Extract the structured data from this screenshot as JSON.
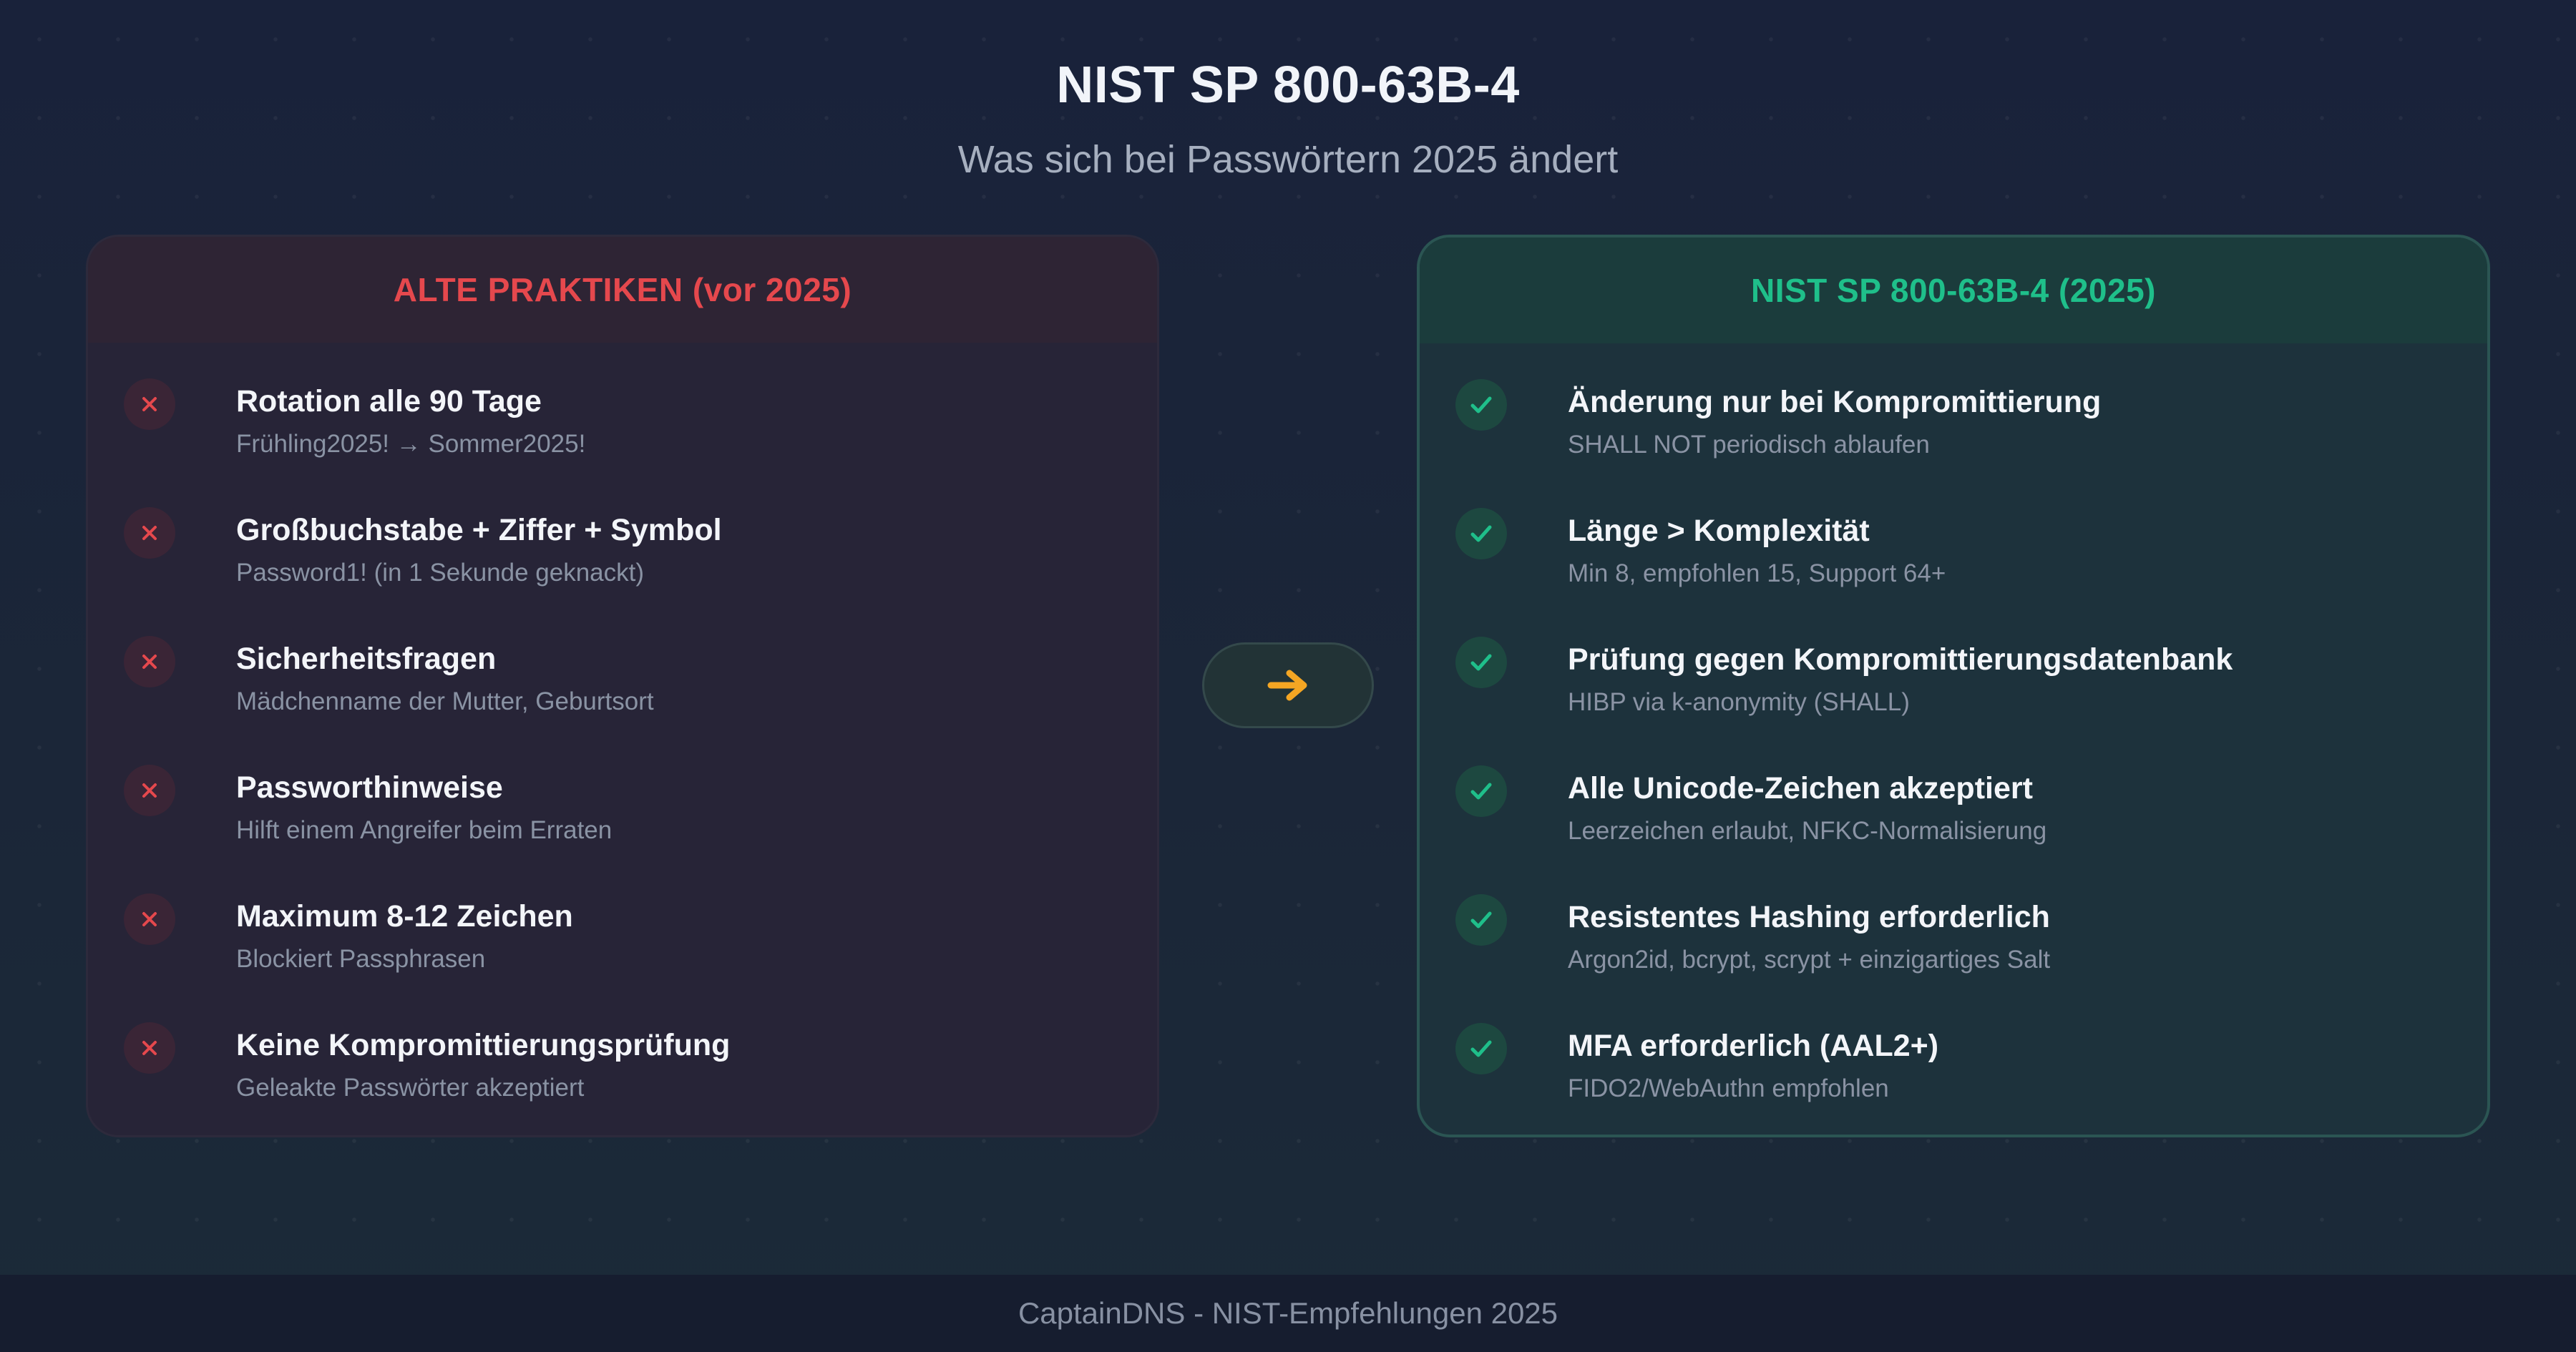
{
  "header": {
    "title": "NIST SP 800-63B-4",
    "subtitle": "Was sich bei Passwörtern 2025 ändert"
  },
  "old_practices": {
    "heading": "ALTE PRAKTIKEN (vor 2025)",
    "accent_color": "#e5484d",
    "items": [
      {
        "title": "Rotation alle 90 Tage",
        "desc": "Frühling2025! → Sommer2025!"
      },
      {
        "title": "Großbuchstabe + Ziffer + Symbol",
        "desc": "Password1! (in 1 Sekunde geknackt)"
      },
      {
        "title": "Sicherheitsfragen",
        "desc": "Mädchenname der Mutter, Geburtsort"
      },
      {
        "title": "Passworthinweise",
        "desc": "Hilft einem Angreifer beim Erraten"
      },
      {
        "title": "Maximum 8-12 Zeichen",
        "desc": "Blockiert Passphrasen"
      },
      {
        "title": "Keine Kompromittierungsprüfung",
        "desc": "Geleakte Passwörter akzeptiert"
      }
    ]
  },
  "new_practices": {
    "heading": "NIST SP 800-63B-4 (2025)",
    "accent_color": "#1fbf8a",
    "items": [
      {
        "title": "Änderung nur bei Kompromittierung",
        "desc": "SHALL NOT periodisch ablaufen"
      },
      {
        "title": "Länge > Komplexität",
        "desc": "Min 8, empfohlen 15, Support 64+"
      },
      {
        "title": "Prüfung gegen Kompromittierungsdatenbank",
        "desc": "HIBP via k-anonymity (SHALL)"
      },
      {
        "title": "Alle Unicode-Zeichen akzeptiert",
        "desc": "Leerzeichen erlaubt, NFKC-Normalisierung"
      },
      {
        "title": "Resistentes Hashing erforderlich",
        "desc": "Argon2id, bcrypt, scrypt + einzigartiges Salt"
      },
      {
        "title": "MFA erforderlich (AAL2+)",
        "desc": "FIDO2/WebAuthn empfohlen"
      }
    ]
  },
  "transition": {
    "icon": "arrow-right-icon",
    "color": "#f5a623"
  },
  "footer": {
    "text": "CaptainDNS - NIST-Empfehlungen 2025"
  }
}
